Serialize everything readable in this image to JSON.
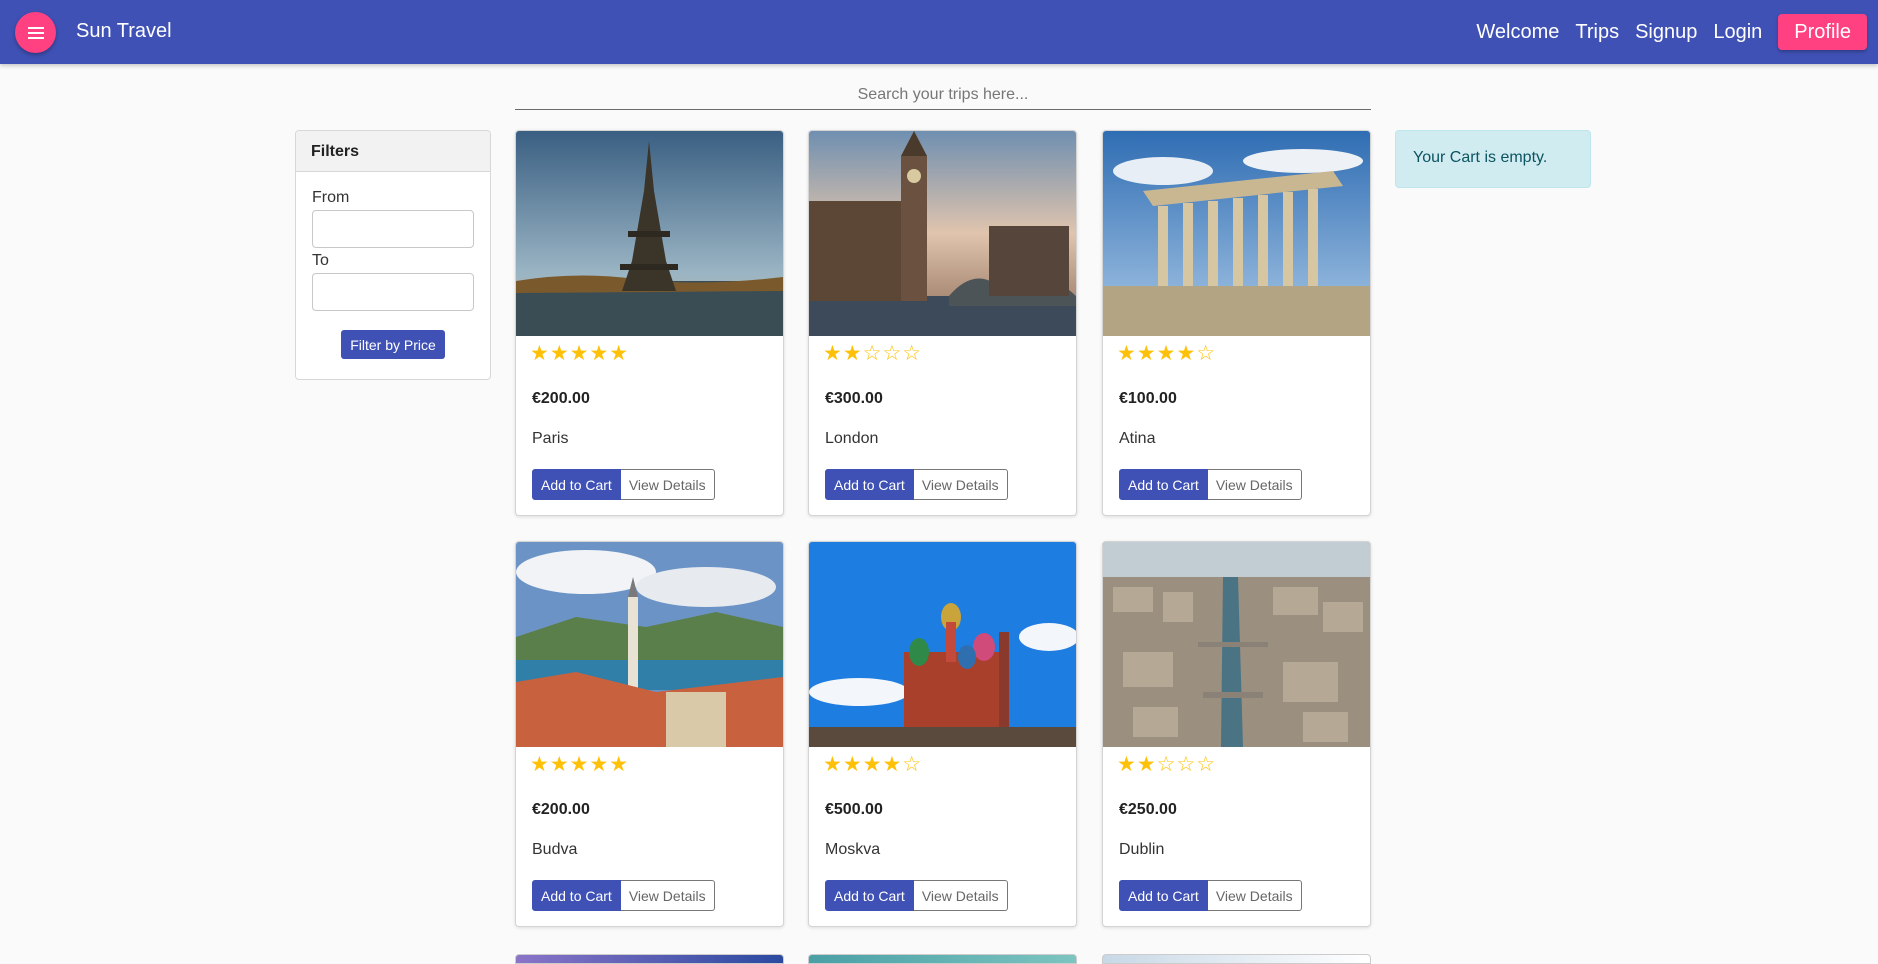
{
  "app": {
    "brand": "Sun Travel",
    "nav": [
      "Welcome",
      "Trips",
      "Signup",
      "Login"
    ],
    "profile_label": "Profile",
    "menu_icon": "menu-icon"
  },
  "colors": {
    "primary": "#3f51b5",
    "accent": "#ff4081",
    "star": "#ffc107",
    "cart_bg": "#d1ecf1"
  },
  "search": {
    "placeholder": "Search your trips here..."
  },
  "filters": {
    "title": "Filters",
    "from_label": "From",
    "from_value": "",
    "to_label": "To",
    "to_value": "",
    "button_label": "Filter by Price"
  },
  "trips": [
    {
      "city": "Paris",
      "price": "€200.00",
      "rating": 5,
      "max_rating": 5,
      "add_label": "Add to Cart",
      "details_label": "View Details"
    },
    {
      "city": "London",
      "price": "€300.00",
      "rating": 2,
      "max_rating": 5,
      "add_label": "Add to Cart",
      "details_label": "View Details"
    },
    {
      "city": "Atina",
      "price": "€100.00",
      "rating": 4,
      "max_rating": 5,
      "add_label": "Add to Cart",
      "details_label": "View Details"
    },
    {
      "city": "Budva",
      "price": "€200.00",
      "rating": 5,
      "max_rating": 5,
      "add_label": "Add to Cart",
      "details_label": "View Details"
    },
    {
      "city": "Moskva",
      "price": "€500.00",
      "rating": 4,
      "max_rating": 5,
      "add_label": "Add to Cart",
      "details_label": "View Details"
    },
    {
      "city": "Dublin",
      "price": "€250.00",
      "rating": 2,
      "max_rating": 5,
      "add_label": "Add to Cart",
      "details_label": "View Details"
    }
  ],
  "cart": {
    "message": "Your Cart is empty."
  }
}
